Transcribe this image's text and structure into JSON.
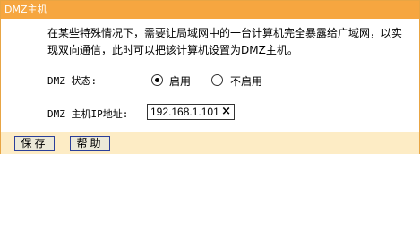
{
  "panel": {
    "title": "DMZ主机",
    "description": "在某些特殊情况下，需要让局域网中的一台计算机完全暴露给广域网，以实现双向通信，此时可以把该计算机设置为DMZ主机。"
  },
  "dmz_status": {
    "label": "DMZ 状态:",
    "options": [
      {
        "label": "启用",
        "checked": true
      },
      {
        "label": "不启用",
        "checked": false
      }
    ]
  },
  "dmz_host_ip": {
    "label": "DMZ 主机IP地址:",
    "value": "192.168.1.101",
    "clear_icon": "×"
  },
  "buttons": {
    "save": "保存",
    "help": "帮助"
  },
  "colors": {
    "title_bar": "#f6a640",
    "footer": "#fdecc5",
    "border": "#e8a544"
  }
}
